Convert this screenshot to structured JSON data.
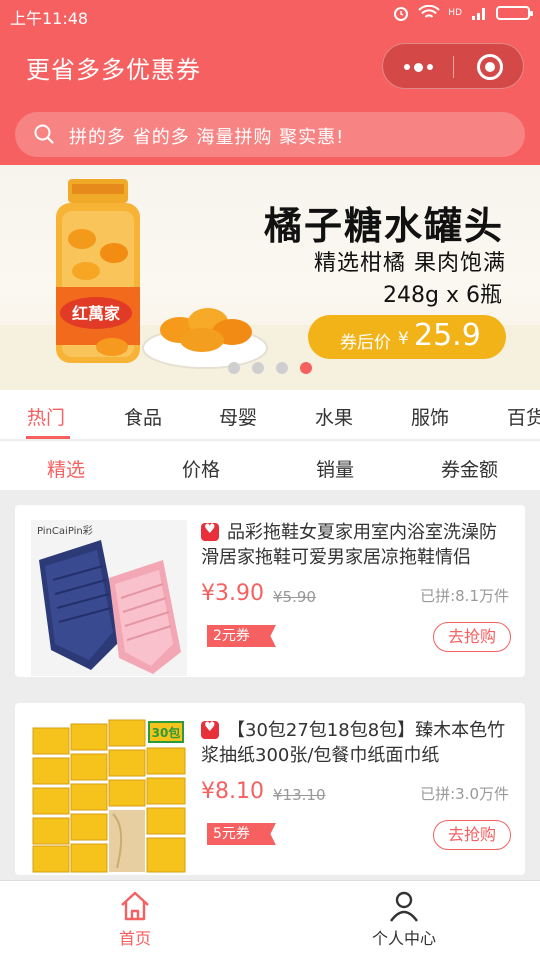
{
  "status": {
    "time": "上午11:48",
    "network": "HD"
  },
  "header": {
    "title": "更省多多优惠券"
  },
  "search": {
    "placeholder": "拼的多 省的多 海量拼购 聚实惠!"
  },
  "banner": {
    "title": "橘子糖水罐头",
    "subtitle": "精选柑橘  果肉饱满",
    "spec": "248g x 6瓶",
    "price_label": "券后价",
    "currency": "¥",
    "price": "25.9",
    "jar_brand": "红萬家",
    "active_dot": 3
  },
  "categories": [
    {
      "label": "热门",
      "active": true
    },
    {
      "label": "食品"
    },
    {
      "label": "母婴"
    },
    {
      "label": "水果"
    },
    {
      "label": "服饰"
    },
    {
      "label": "百货"
    }
  ],
  "sorts": [
    {
      "label": "精选",
      "active": true
    },
    {
      "label": "价格"
    },
    {
      "label": "销量"
    },
    {
      "label": "券金额"
    }
  ],
  "products": [
    {
      "title": "品彩拖鞋女夏家用室内浴室洗澡防滑居家拖鞋可爱男家居凉拖鞋情侣",
      "price": "¥3.90",
      "original_price": "¥5.90",
      "sold": "已拼:8.1万件",
      "coupon": "2元券",
      "action": "去抢购",
      "image_brand": "PinCaiPin彩"
    },
    {
      "title": "【30包27包18包8包】臻木本色竹浆抽纸300张/包餐巾纸面巾纸",
      "price": "¥8.10",
      "original_price": "¥13.10",
      "sold": "已拼:3.0万件",
      "coupon": "5元券",
      "action": "去抢购",
      "image_badge": "30包"
    }
  ],
  "tabbar": {
    "home": "首页",
    "me": "个人中心"
  },
  "colors": {
    "brand": "#f66060",
    "price_pill": "#f2b318",
    "bg": "#ededed"
  }
}
